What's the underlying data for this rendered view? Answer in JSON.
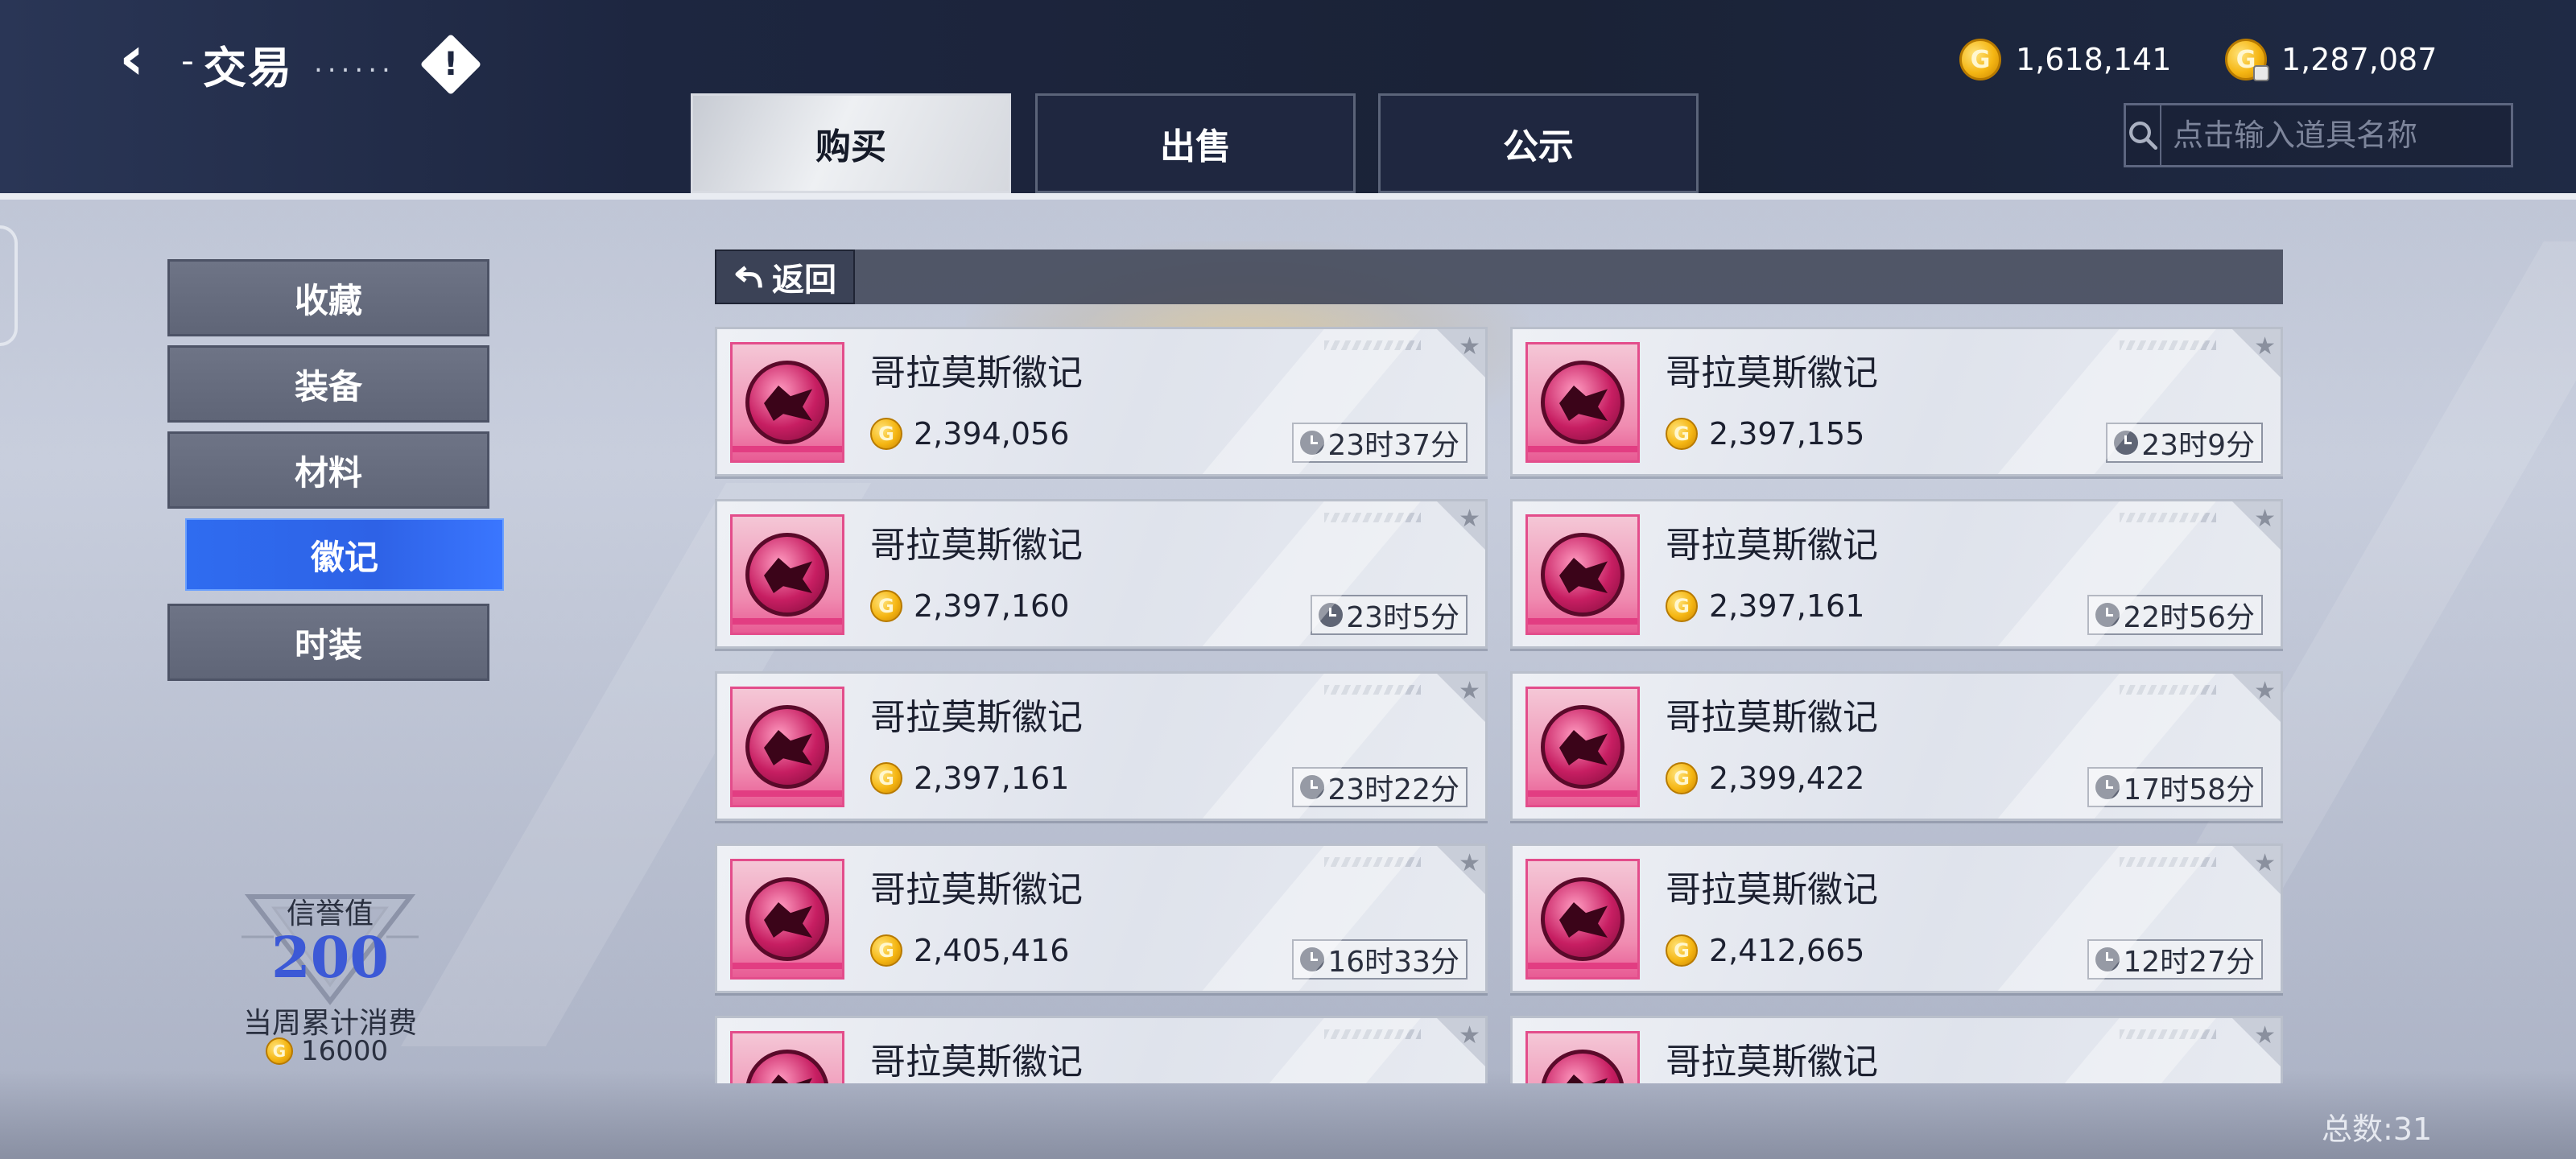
{
  "header": {
    "back_glyph": "‹",
    "title": "交易",
    "title_suffix": "......",
    "info_glyph": "!",
    "currencies": [
      {
        "icon": "gold-coin-icon",
        "value": "1,618,141"
      },
      {
        "icon": "bound-gold-coin-icon",
        "value": "1,287,087"
      }
    ],
    "tabs": [
      {
        "label": "购买",
        "active": true
      },
      {
        "label": "出售",
        "active": false
      },
      {
        "label": "公示",
        "active": false
      }
    ],
    "search": {
      "placeholder": "点击输入道具名称"
    }
  },
  "sidebar": {
    "items": [
      {
        "label": "收藏",
        "active": false
      },
      {
        "label": "装备",
        "active": false
      },
      {
        "label": "材料",
        "active": false
      },
      {
        "label": "徽记",
        "active": true
      },
      {
        "label": "时装",
        "active": false
      }
    ],
    "credit": {
      "label": "信誉值",
      "value": "200",
      "weekly_label": "当周累计消费",
      "weekly_value": "16000"
    }
  },
  "main": {
    "return_label": "返回",
    "coin_glyph": "G",
    "star_glyph": "★",
    "listings": [
      {
        "name": "哥拉莫斯徽记",
        "price": "2,394,056",
        "time": "23时37分"
      },
      {
        "name": "哥拉莫斯徽记",
        "price": "2,397,155",
        "time": "23时9分"
      },
      {
        "name": "哥拉莫斯徽记",
        "price": "2,397,160",
        "time": "23时5分"
      },
      {
        "name": "哥拉莫斯徽记",
        "price": "2,397,161",
        "time": "22时56分"
      },
      {
        "name": "哥拉莫斯徽记",
        "price": "2,397,161",
        "time": "23时22分"
      },
      {
        "name": "哥拉莫斯徽记",
        "price": "2,399,422",
        "time": "17时58分"
      },
      {
        "name": "哥拉莫斯徽记",
        "price": "2,405,416",
        "time": "16时33分"
      },
      {
        "name": "哥拉莫斯徽记",
        "price": "2,412,665",
        "time": "12时27分"
      },
      {
        "name": "哥拉莫斯徽记",
        "price": "",
        "time": ""
      },
      {
        "name": "哥拉莫斯徽记",
        "price": "",
        "time": ""
      }
    ],
    "total": "总数:31"
  },
  "colors": {
    "header_bg": "#1d2640",
    "active_tab": "#e9ecf0",
    "active_side": "#2f6cf0",
    "credit_value": "#3c59d6",
    "coin": "#f5b613",
    "emblem_pink": "#e85b94"
  }
}
